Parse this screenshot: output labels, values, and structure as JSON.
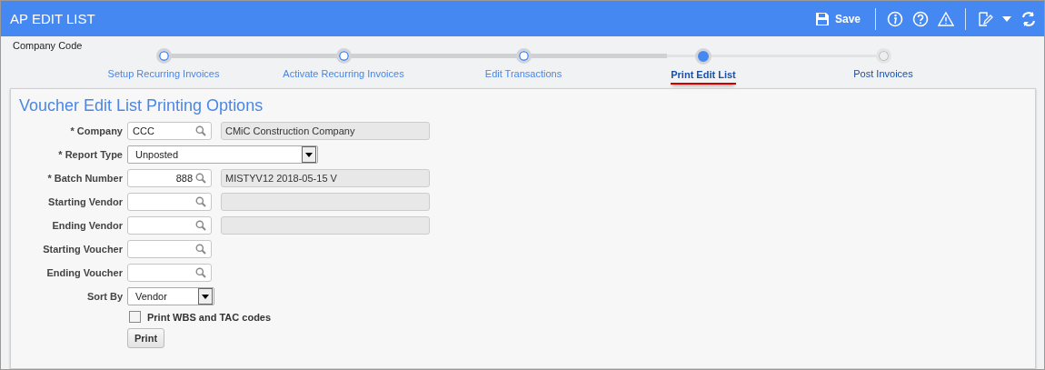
{
  "window": {
    "title": "AP EDIT LIST"
  },
  "toolbar": {
    "save_label": "Save"
  },
  "company_code_label": "Company Code",
  "steps": [
    {
      "label": "Setup Recurring Invoices",
      "completed": true,
      "selected": false
    },
    {
      "label": "Activate Recurring Invoices",
      "completed": true,
      "selected": false
    },
    {
      "label": "Edit Transactions",
      "completed": true,
      "selected": false
    },
    {
      "label": "Print Edit List",
      "completed": false,
      "selected": true
    },
    {
      "label": "Post Invoices",
      "completed": false,
      "selected": false
    }
  ],
  "panel": {
    "title": "Voucher Edit List Printing Options",
    "fields": [
      {
        "kind": "lookup_desc",
        "label": "* Company",
        "value": "CCC",
        "numeric": false,
        "description": "CMiC Construction Company"
      },
      {
        "kind": "select",
        "label": "* Report Type",
        "value": "Unposted",
        "wide": true
      },
      {
        "kind": "lookup_desc",
        "label": "* Batch Number",
        "value": "888",
        "numeric": true,
        "description": "MISTYV12 2018-05-15 V"
      },
      {
        "kind": "lookup_desc",
        "label": "Starting Vendor"
      },
      {
        "kind": "lookup_desc",
        "label": "Ending Vendor"
      },
      {
        "kind": "lookup",
        "label": "Starting Voucher"
      },
      {
        "kind": "lookup",
        "label": "Ending Voucher"
      },
      {
        "kind": "select",
        "label": "Sort By",
        "value": "Vendor",
        "wide": false
      },
      {
        "kind": "checkbox",
        "label": "Print WBS and TAC codes",
        "checked": false
      },
      {
        "kind": "button",
        "label": "Print"
      }
    ]
  }
}
